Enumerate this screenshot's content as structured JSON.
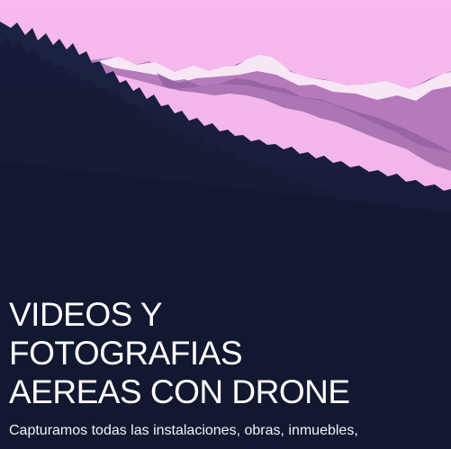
{
  "hero": {
    "title_lines": [
      "VIDEOS Y",
      "FOTOGRAFIAS",
      "AEREAS CON DRONE"
    ],
    "subtitle": "Capturamos todas las instalaciones, obras, inmuebles,"
  },
  "colors": {
    "sky": "#f2b8ea",
    "mountain_shadow": "#b77bbd",
    "snow": "#f7e8f5",
    "forest": "#12172f",
    "text": "#ffffff"
  },
  "icons": {
    "hero_background": "mountain-forest-photo"
  }
}
